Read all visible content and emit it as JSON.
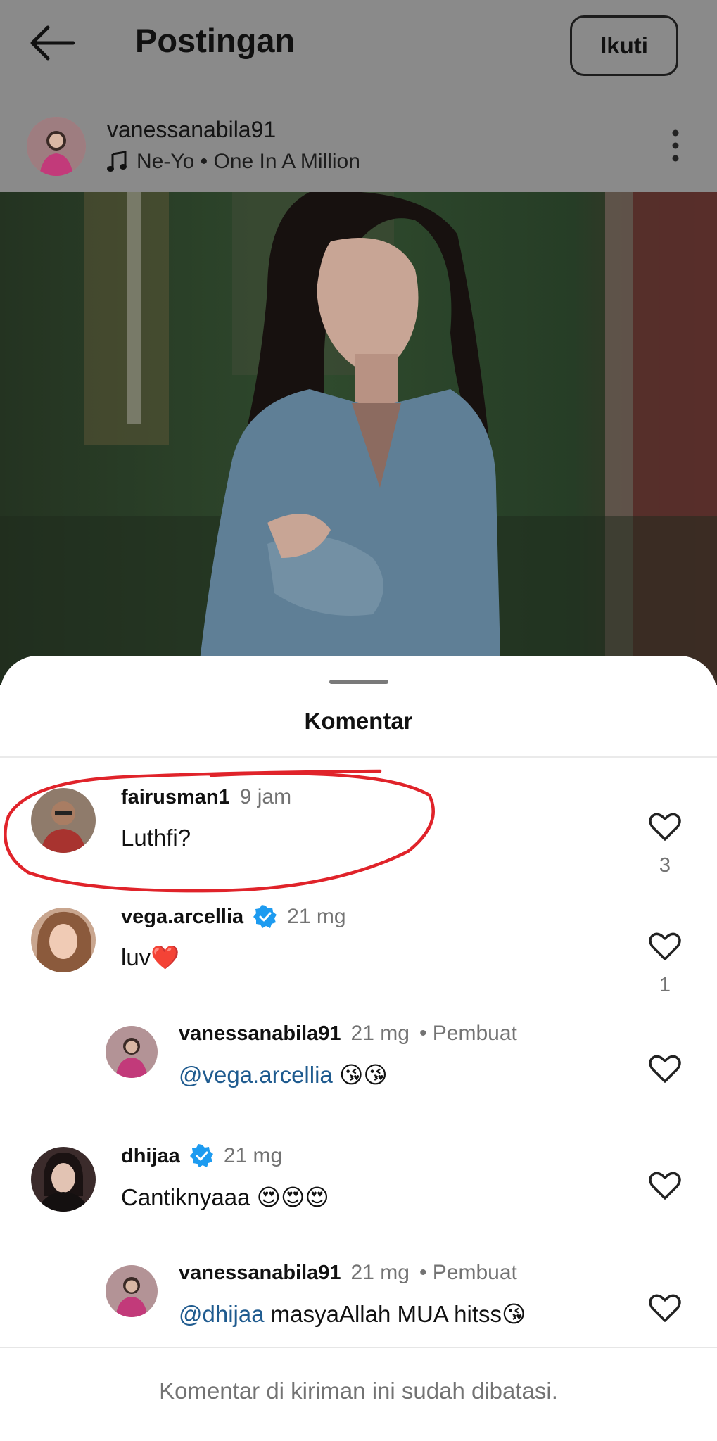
{
  "header": {
    "title": "Postingan",
    "follow_label": "Ikuti",
    "username": "vanessanabila91",
    "music": "Ne-Yo • One In A Million"
  },
  "sheet": {
    "title": "Komentar",
    "footer_note": "Komentar di kiriman ini sudah dibatasi."
  },
  "comments": [
    {
      "username": "fairusman1",
      "time": "9 jam",
      "text": "Luthfi?",
      "likes": "3",
      "verified": false
    },
    {
      "username": "vega.arcellia",
      "time": "21 mg",
      "text": "luv❤️",
      "likes": "1",
      "verified": true
    },
    {
      "username": "vanessanabila91",
      "time": "21 mg",
      "author_tag": "• Pembuat",
      "mention": "@vega.arcellia",
      "text": " 😘😘",
      "reply": true
    },
    {
      "username": "dhijaa",
      "time": "21 mg",
      "text": "Cantiknyaaa 😍😍😍",
      "verified": true
    },
    {
      "username": "vanessanabila91",
      "time": "21 mg",
      "author_tag": "• Pembuat",
      "mention": "@dhijaa",
      "text": " masyaAllah MUA hitss😘",
      "reply": true
    }
  ],
  "colors": {
    "mention": "#1f5b8f",
    "verified": "#1d9bf0",
    "annotation": "#e0232a"
  }
}
